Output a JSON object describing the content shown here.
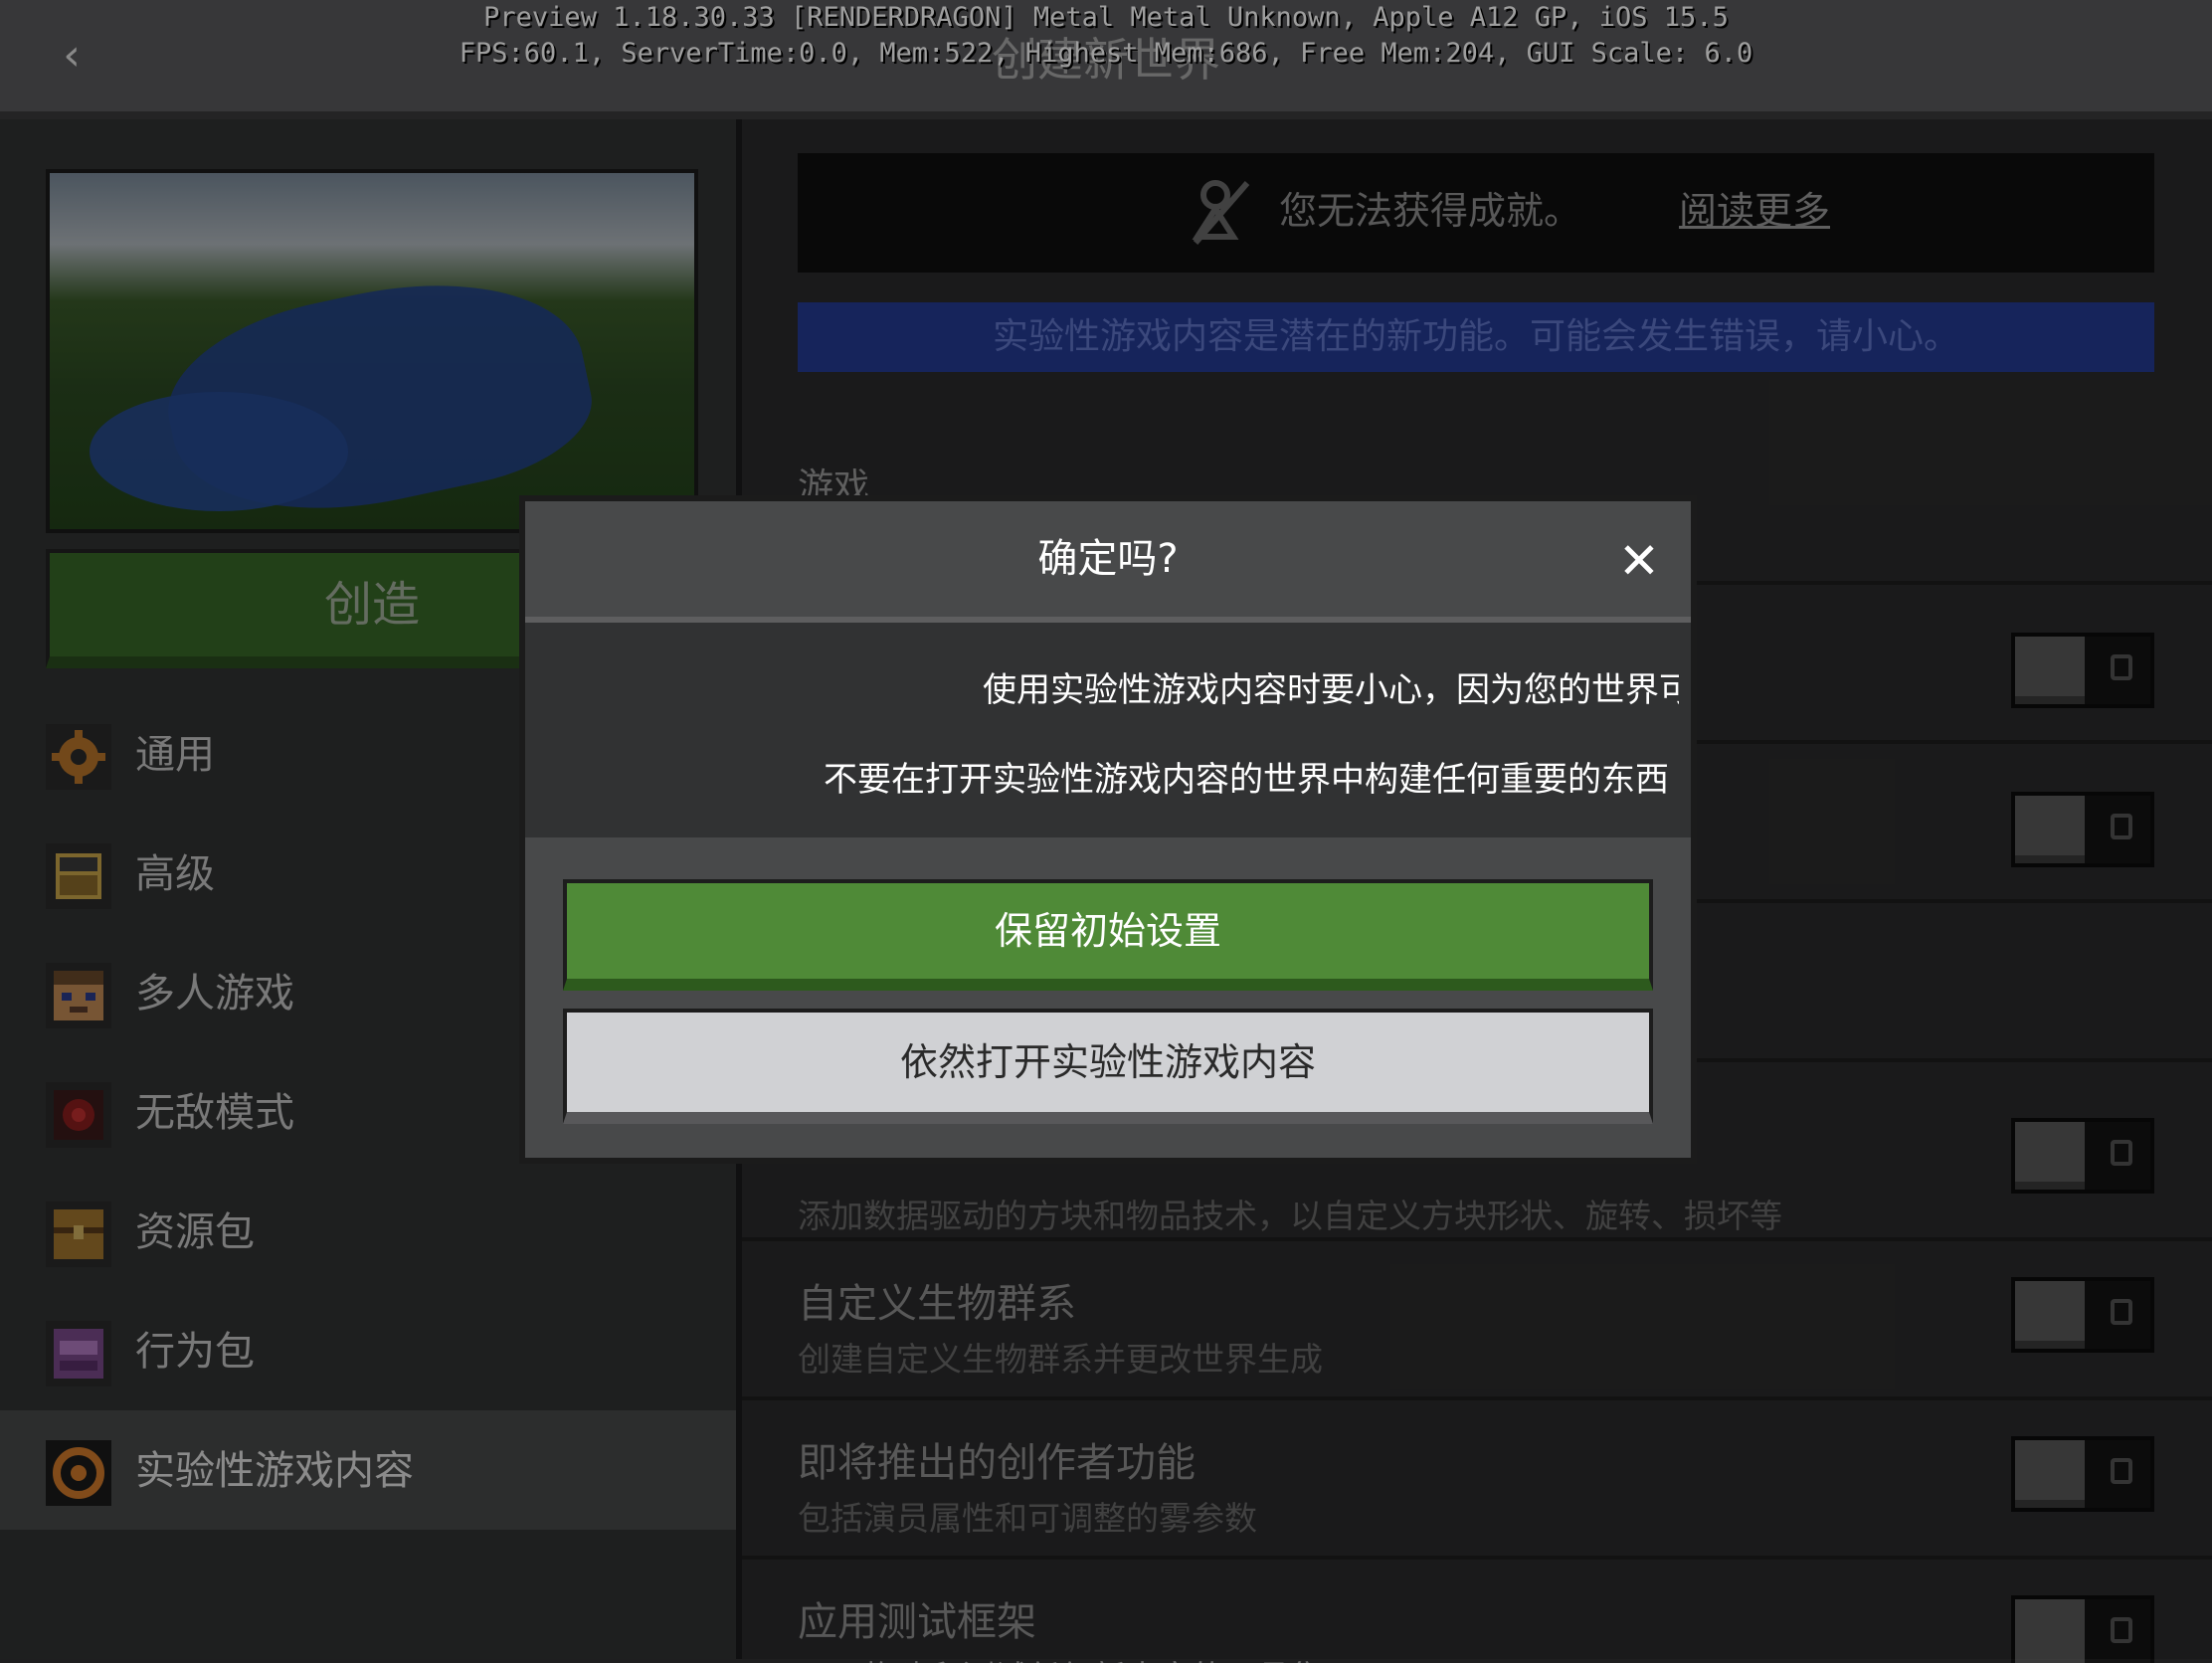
{
  "header": {
    "back_icon": "chevron-left-icon",
    "back_glyph": "‹",
    "title": "创建新世界",
    "debug_line1": "Preview 1.18.30.33 [RENDERDRAGON] Metal Metal Unknown, Apple A12 GP, iOS 15.5",
    "debug_line2": "FPS:60.1, ServerTime:0.0, Mem:522, Highest Mem:686, Free Mem:204, GUI Scale: 6.0"
  },
  "sidebar": {
    "create_label": "创造",
    "items": [
      {
        "label": "通用",
        "icon": "gear-icon",
        "color": "#b8742a"
      },
      {
        "label": "高级",
        "icon": "chest-icon",
        "color": "#c9a54a"
      },
      {
        "label": "多人游戏",
        "icon": "player-head-icon",
        "color": "#c08a55"
      },
      {
        "label": "无敌模式",
        "icon": "heart-block-icon",
        "color": "#8a1e1e"
      },
      {
        "label": "资源包",
        "icon": "resource-pack-icon",
        "color": "#a0742e"
      },
      {
        "label": "行为包",
        "icon": "behavior-pack-icon",
        "color": "#7a4a8a"
      },
      {
        "label": "实验性游戏内容",
        "icon": "experiments-icon",
        "color": "#d07a2a"
      }
    ]
  },
  "main": {
    "achievement_text": "您无法获得成就。",
    "achievement_link": "阅读更多",
    "warning_banner": "实验性游戏内容是潜在的新功能。可能会发生错误，请小心。",
    "section_title": "游戏",
    "rows": [
      {
        "title": "",
        "desc": "添加数据驱动的方块和物品技术，以自定义方块形状、旋转、损坏等"
      },
      {
        "title": "自定义生物群系",
        "desc": "创建自定义生物群系并更改世界生成"
      },
      {
        "title": "即将推出的创作者功能",
        "desc": "包括演员属性和可调整的雾参数"
      },
      {
        "title": "应用测试框架",
        "desc": "用于构建和测试任何新内容的工具集"
      }
    ]
  },
  "dialog": {
    "title": "确定吗?",
    "close_icon": "close-icon",
    "close_glyph": "✕",
    "line1": "使用实验性游戏内容时要小心，因为您的世界可能会损坏",
    "line2": "不要在打开实验性游戏内容的世界中构建任何重要的东西",
    "keep_button": "保留初始设置",
    "open_button": "依然打开实验性游戏内容"
  },
  "colors": {
    "accent_green": "#4f8a37",
    "warning_blue": "#253a93"
  }
}
